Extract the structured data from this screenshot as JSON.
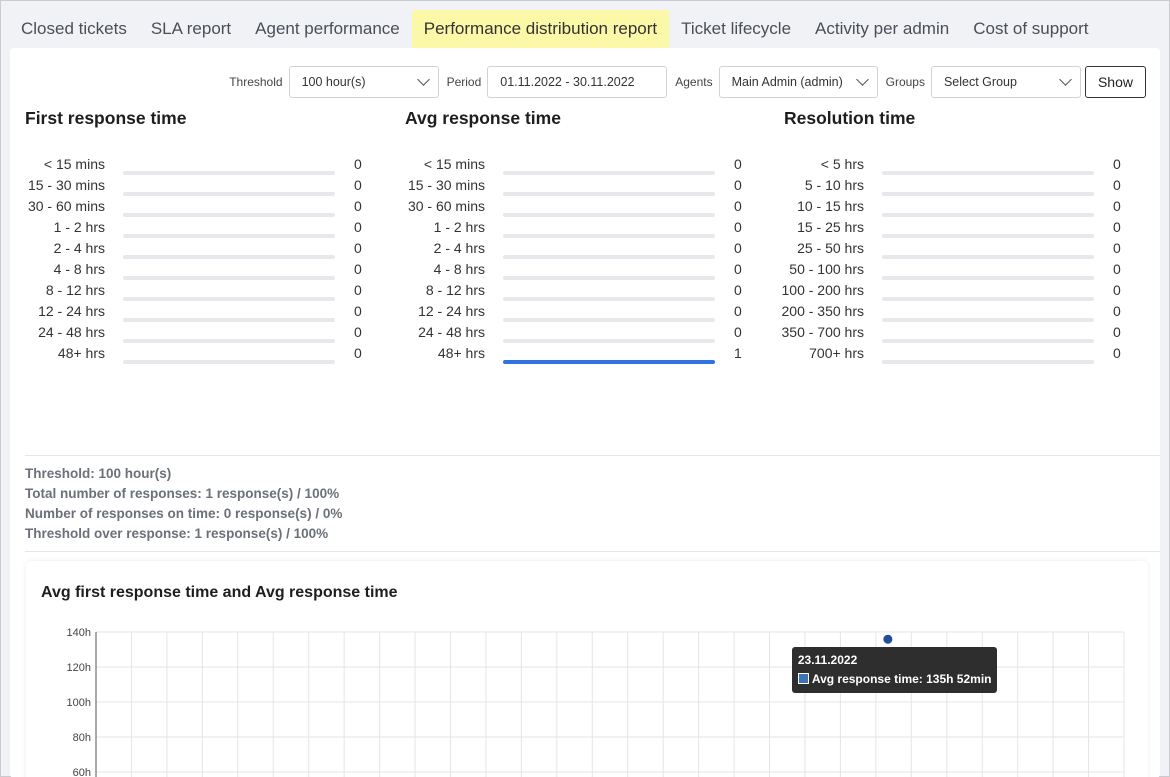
{
  "tabs": [
    {
      "label": "Closed tickets",
      "active": false
    },
    {
      "label": "SLA report",
      "active": false
    },
    {
      "label": "Agent performance",
      "active": false
    },
    {
      "label": "Performance distribution report",
      "active": true
    },
    {
      "label": "Ticket lifecycle",
      "active": false
    },
    {
      "label": "Activity per admin",
      "active": false
    },
    {
      "label": "Cost of support",
      "active": false
    }
  ],
  "filters": {
    "threshold_label": "Threshold",
    "threshold_value": "100 hour(s)",
    "period_label": "Period",
    "period_value": "01.11.2022 - 30.11.2022",
    "agents_label": "Agents",
    "agents_value": "Main Admin (admin)",
    "groups_label": "Groups",
    "groups_value": "Select Group",
    "show_button": "Show"
  },
  "distributions": [
    {
      "title": "First response time",
      "rows": [
        {
          "label": "< 15 mins",
          "value": 0
        },
        {
          "label": "15 - 30 mins",
          "value": 0
        },
        {
          "label": "30 - 60 mins",
          "value": 0
        },
        {
          "label": "1 - 2 hrs",
          "value": 0
        },
        {
          "label": "2 - 4 hrs",
          "value": 0
        },
        {
          "label": "4 - 8 hrs",
          "value": 0
        },
        {
          "label": "8 - 12 hrs",
          "value": 0
        },
        {
          "label": "12 - 24 hrs",
          "value": 0
        },
        {
          "label": "24 - 48 hrs",
          "value": 0
        },
        {
          "label": "48+ hrs",
          "value": 0
        }
      ]
    },
    {
      "title": "Avg response time",
      "rows": [
        {
          "label": "< 15 mins",
          "value": 0
        },
        {
          "label": "15 - 30 mins",
          "value": 0
        },
        {
          "label": "30 - 60 mins",
          "value": 0
        },
        {
          "label": "1 - 2 hrs",
          "value": 0
        },
        {
          "label": "2 - 4 hrs",
          "value": 0
        },
        {
          "label": "4 - 8 hrs",
          "value": 0
        },
        {
          "label": "8 - 12 hrs",
          "value": 0
        },
        {
          "label": "12 - 24 hrs",
          "value": 0
        },
        {
          "label": "24 - 48 hrs",
          "value": 0
        },
        {
          "label": "48+ hrs",
          "value": 1
        }
      ]
    },
    {
      "title": "Resolution time",
      "rows": [
        {
          "label": "< 5 hrs",
          "value": 0
        },
        {
          "label": "5 - 10 hrs",
          "value": 0
        },
        {
          "label": "10 - 15 hrs",
          "value": 0
        },
        {
          "label": "15 - 25 hrs",
          "value": 0
        },
        {
          "label": "25 - 50 hrs",
          "value": 0
        },
        {
          "label": "50 - 100 hrs",
          "value": 0
        },
        {
          "label": "100 - 200 hrs",
          "value": 0
        },
        {
          "label": "200 - 350 hrs",
          "value": 0
        },
        {
          "label": "350 - 700 hrs",
          "value": 0
        },
        {
          "label": "700+ hrs",
          "value": 0
        }
      ]
    }
  ],
  "summary": [
    "Threshold: 100 hour(s)",
    "Total number of responses: 1 response(s) / 100%",
    "Number of responses on time: 0 response(s) / 0%",
    "Threshold over response: 1 response(s) / 100%"
  ],
  "chart_title": "Avg first response time and Avg response time",
  "chart_data": {
    "type": "line",
    "title": "Avg first response time and Avg response time",
    "y_ticks": [
      "140h",
      "120h",
      "100h",
      "80h",
      "60h"
    ],
    "ylim_visible": [
      60,
      140
    ],
    "x_range_visible": [
      "01.11.2022",
      "30.11.2022"
    ],
    "grid": true,
    "series": [
      {
        "name": "Avg response time",
        "points": [
          {
            "x": "23.11.2022",
            "y": 135.87
          }
        ]
      }
    ],
    "tooltip": {
      "date": "23.11.2022",
      "series": "Avg response time",
      "text": "Avg response time: 135h 52min"
    },
    "colors": {
      "point": "#1f4e9c",
      "swatch": "#3a73b8"
    }
  },
  "colors": {
    "active_tab": "#fbf8a8",
    "bar_fill": "#2f73e3",
    "bar_track": "#e7e8ec"
  }
}
